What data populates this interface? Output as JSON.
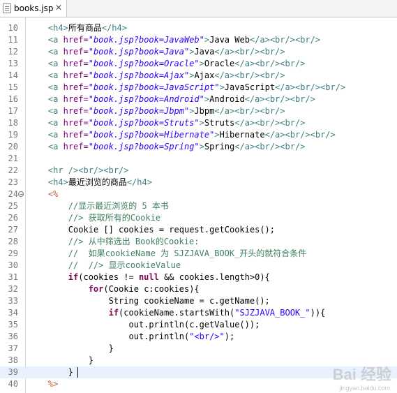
{
  "editor": {
    "tab_title": "books.jsp",
    "close_glyph": "✕",
    "cursor_line": 39
  },
  "colors": {
    "tag": "#3f7f7f",
    "attribute": "#7f007f",
    "string": "#2a00ff",
    "comment": "#3f7f5f",
    "keyword": "#7f0055",
    "scriptlet": "#bf5f3f",
    "current_line": "#e8f2fe"
  },
  "lines": [
    {
      "n": "10",
      "tokens": [
        [
          "plain",
          "    "
        ],
        [
          "tag",
          "<h4>"
        ],
        [
          "plain",
          "所有商品"
        ],
        [
          "tag",
          "</h4>"
        ]
      ]
    },
    {
      "n": "11",
      "tokens": [
        [
          "plain",
          "    "
        ],
        [
          "tag",
          "<a "
        ],
        [
          "attr",
          "href="
        ],
        [
          "str",
          "\"book.jsp?book=JavaWeb\""
        ],
        [
          "tag",
          ">"
        ],
        [
          "plain",
          "Java Web"
        ],
        [
          "tag",
          "</a><br/><br/>"
        ]
      ]
    },
    {
      "n": "12",
      "tokens": [
        [
          "plain",
          "    "
        ],
        [
          "tag",
          "<a "
        ],
        [
          "attr",
          "href="
        ],
        [
          "str",
          "\"book.jsp?book=Java\""
        ],
        [
          "tag",
          ">"
        ],
        [
          "plain",
          "Java"
        ],
        [
          "tag",
          "</a><br/><br/>"
        ]
      ]
    },
    {
      "n": "13",
      "tokens": [
        [
          "plain",
          "    "
        ],
        [
          "tag",
          "<a "
        ],
        [
          "attr",
          "href="
        ],
        [
          "str",
          "\"book.jsp?book=Oracle\""
        ],
        [
          "tag",
          ">"
        ],
        [
          "plain",
          "Oracle"
        ],
        [
          "tag",
          "</a><br/><br/>"
        ]
      ]
    },
    {
      "n": "14",
      "tokens": [
        [
          "plain",
          "    "
        ],
        [
          "tag",
          "<a "
        ],
        [
          "attr",
          "href="
        ],
        [
          "str",
          "\"book.jsp?book=Ajax\""
        ],
        [
          "tag",
          ">"
        ],
        [
          "plain",
          "Ajax"
        ],
        [
          "tag",
          "</a><br/><br/>"
        ]
      ]
    },
    {
      "n": "15",
      "tokens": [
        [
          "plain",
          "    "
        ],
        [
          "tag",
          "<a "
        ],
        [
          "attr",
          "href="
        ],
        [
          "str",
          "\"book.jsp?book=JavaScript\""
        ],
        [
          "tag",
          ">"
        ],
        [
          "plain",
          "JavaScript"
        ],
        [
          "tag",
          "</a><br/><br/>"
        ]
      ]
    },
    {
      "n": "16",
      "tokens": [
        [
          "plain",
          "    "
        ],
        [
          "tag",
          "<a "
        ],
        [
          "attr",
          "href="
        ],
        [
          "str",
          "\"book.jsp?book=Android\""
        ],
        [
          "tag",
          ">"
        ],
        [
          "plain",
          "Android"
        ],
        [
          "tag",
          "</a><br/><br/>"
        ]
      ]
    },
    {
      "n": "17",
      "tokens": [
        [
          "plain",
          "    "
        ],
        [
          "tag",
          "<a "
        ],
        [
          "attr",
          "href="
        ],
        [
          "str",
          "\"book.jsp?book=Jbpm\""
        ],
        [
          "tag",
          ">"
        ],
        [
          "plain",
          "Jbpm"
        ],
        [
          "tag",
          "</a><br/><br/>"
        ]
      ]
    },
    {
      "n": "18",
      "tokens": [
        [
          "plain",
          "    "
        ],
        [
          "tag",
          "<a "
        ],
        [
          "attr",
          "href="
        ],
        [
          "str",
          "\"book.jsp?book=Struts\""
        ],
        [
          "tag",
          ">"
        ],
        [
          "plain",
          "Struts"
        ],
        [
          "tag",
          "</a><br/><br/>"
        ]
      ]
    },
    {
      "n": "19",
      "tokens": [
        [
          "plain",
          "    "
        ],
        [
          "tag",
          "<a "
        ],
        [
          "attr",
          "href="
        ],
        [
          "str",
          "\"book.jsp?book=Hibernate\""
        ],
        [
          "tag",
          ">"
        ],
        [
          "plain",
          "Hibernate"
        ],
        [
          "tag",
          "</a><br/><br/>"
        ]
      ]
    },
    {
      "n": "20",
      "tokens": [
        [
          "plain",
          "    "
        ],
        [
          "tag",
          "<a "
        ],
        [
          "attr",
          "href="
        ],
        [
          "str",
          "\"book.jsp?book=Spring\""
        ],
        [
          "tag",
          ">"
        ],
        [
          "plain",
          "Spring"
        ],
        [
          "tag",
          "</a><br/><br/>"
        ]
      ]
    },
    {
      "n": "21",
      "tokens": []
    },
    {
      "n": "22",
      "tokens": [
        [
          "plain",
          "    "
        ],
        [
          "tag",
          "<hr /><br/><br/>"
        ]
      ]
    },
    {
      "n": "23",
      "tokens": [
        [
          "plain",
          "    "
        ],
        [
          "tag",
          "<h4>"
        ],
        [
          "plain",
          "最近浏览的商品"
        ],
        [
          "tag",
          "</h4>"
        ]
      ]
    },
    {
      "n": "24",
      "marker": "⊖",
      "tokens": [
        [
          "plain",
          "    "
        ],
        [
          "scrip",
          "<%"
        ]
      ]
    },
    {
      "n": "25",
      "tokens": [
        [
          "plain",
          "        "
        ],
        [
          "comment",
          "//显示最近浏览的 5 本书"
        ]
      ]
    },
    {
      "n": "26",
      "tokens": [
        [
          "plain",
          "        "
        ],
        [
          "comment",
          "//> 获取所有的Cookie"
        ]
      ]
    },
    {
      "n": "27",
      "tokens": [
        [
          "plain",
          "        Cookie [] cookies = request.getCookies();"
        ]
      ]
    },
    {
      "n": "28",
      "tokens": [
        [
          "plain",
          "        "
        ],
        [
          "comment",
          "//> 从中筛选出 Book的Cookie:"
        ]
      ]
    },
    {
      "n": "29",
      "tokens": [
        [
          "plain",
          "        "
        ],
        [
          "comment",
          "//  如果cookieName 为 SJZJAVA_BOOK_开头的就符合条件"
        ]
      ]
    },
    {
      "n": "30",
      "tokens": [
        [
          "plain",
          "        "
        ],
        [
          "comment",
          "//  //> 显示cookieValue"
        ]
      ]
    },
    {
      "n": "31",
      "tokens": [
        [
          "plain",
          "        "
        ],
        [
          "kw",
          "if"
        ],
        [
          "plain",
          "(cookies != "
        ],
        [
          "kw",
          "null"
        ],
        [
          "plain",
          " && cookies.length>0){"
        ]
      ]
    },
    {
      "n": "32",
      "tokens": [
        [
          "plain",
          "            "
        ],
        [
          "kw",
          "for"
        ],
        [
          "plain",
          "(Cookie c:cookies){"
        ]
      ]
    },
    {
      "n": "33",
      "tokens": [
        [
          "plain",
          "                String cookieName = c.getName();"
        ]
      ]
    },
    {
      "n": "34",
      "tokens": [
        [
          "plain",
          "                "
        ],
        [
          "kw",
          "if"
        ],
        [
          "plain",
          "(cookieName.startsWith("
        ],
        [
          "jstr",
          "\"SJZJAVA_BOOK_\""
        ],
        [
          "plain",
          "))"
        ],
        [
          "plain",
          "{"
        ]
      ]
    },
    {
      "n": "35",
      "tokens": [
        [
          "plain",
          "                    out.println(c.getValue());"
        ]
      ]
    },
    {
      "n": "36",
      "tokens": [
        [
          "plain",
          "                    out.println("
        ],
        [
          "jstr",
          "\"<br/>\""
        ],
        [
          "plain",
          ");"
        ]
      ]
    },
    {
      "n": "37",
      "tokens": [
        [
          "plain",
          "                }"
        ]
      ]
    },
    {
      "n": "38",
      "tokens": [
        [
          "plain",
          "            }"
        ]
      ]
    },
    {
      "n": "39",
      "tokens": [
        [
          "plain",
          "        }"
        ]
      ]
    },
    {
      "n": "40",
      "tokens": [
        [
          "plain",
          "    "
        ],
        [
          "scrip",
          "%>"
        ]
      ]
    }
  ],
  "watermark": {
    "main": "Bai 经验",
    "sub": "jingyan.baidu.com"
  }
}
